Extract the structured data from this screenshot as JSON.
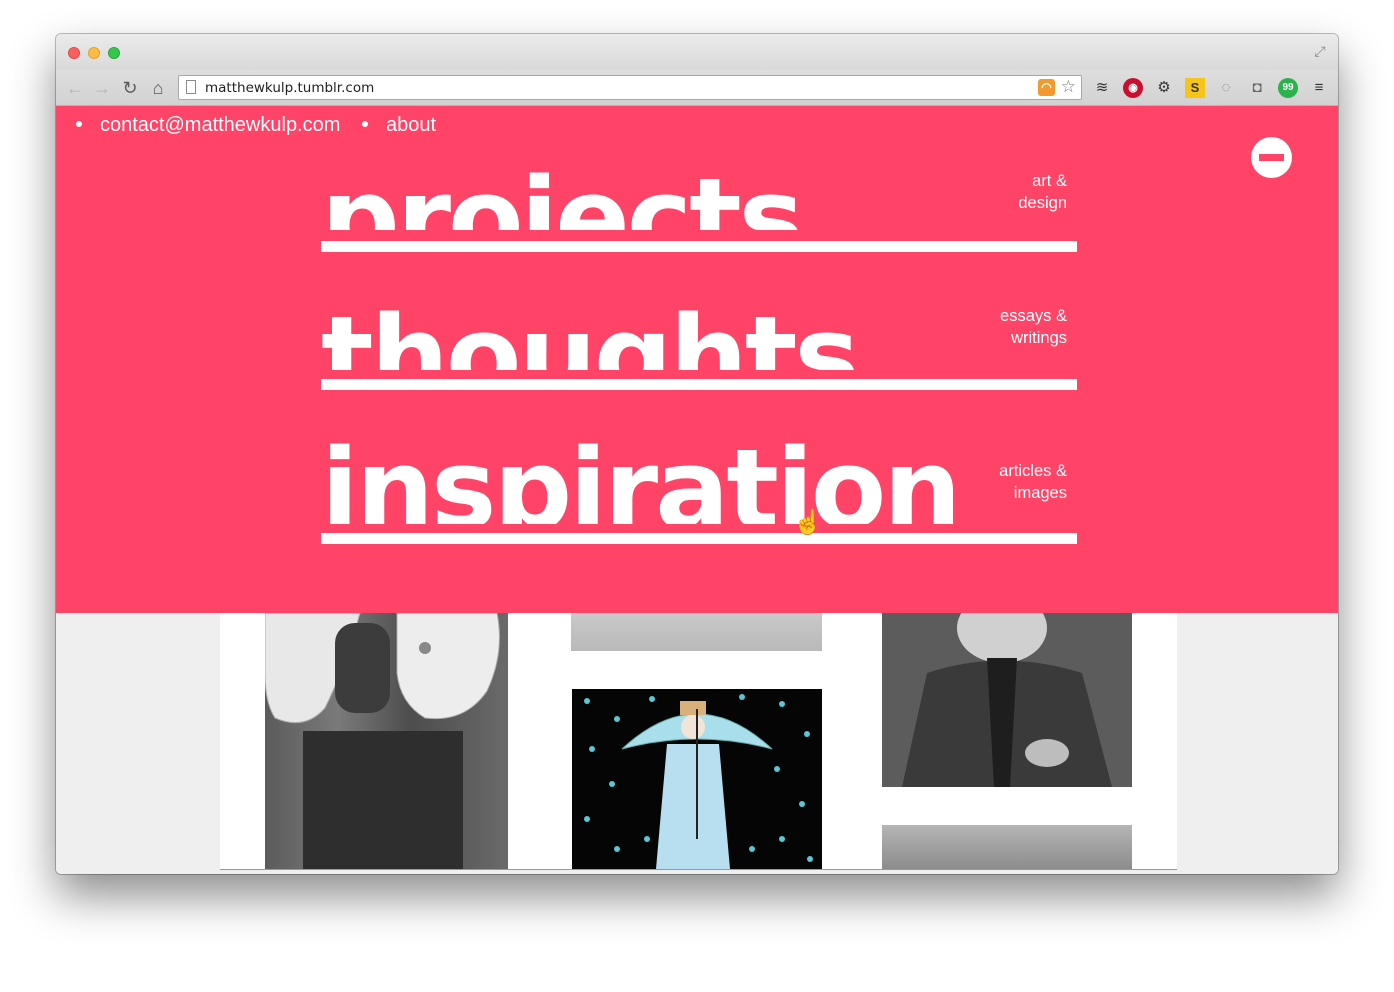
{
  "browser": {
    "url": "matthewkulp.tumblr.com",
    "nav": {
      "back_icon": "←",
      "forward_icon": "→",
      "reload_icon": "↻",
      "home_icon": "⌂"
    },
    "omnibox_icons": {
      "rss": "◠",
      "star": "☆"
    },
    "extensions": [
      "≋",
      "◉",
      "⚙",
      "S",
      "◌",
      "◘",
      "99",
      "≡"
    ],
    "fullscreen_icon": "⤢"
  },
  "site": {
    "topnav": {
      "contact": "contact@matthewkulp.com",
      "about": "about"
    },
    "menu": [
      {
        "word": "projects",
        "sub_line1": "art &",
        "sub_line2": "design"
      },
      {
        "word": "thoughts",
        "sub_line1": "essays &",
        "sub_line2": "writings"
      },
      {
        "word": "inspiration",
        "sub_line1": "articles &",
        "sub_line2": "images"
      }
    ],
    "colors": {
      "accent": "#ff4468",
      "text": "#ffffff",
      "page_bg": "#efefef"
    }
  }
}
